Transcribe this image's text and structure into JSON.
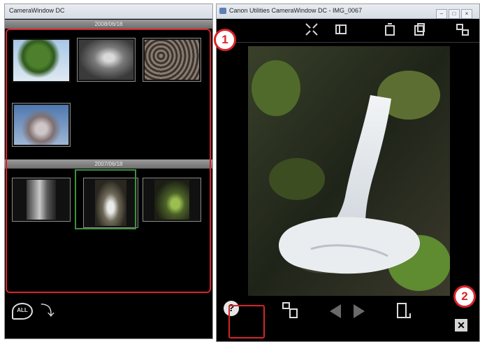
{
  "left_window": {
    "title": "CameraWindow DC",
    "group1_label": "2008/06/18",
    "group2_label": "2007/06/18",
    "bottom_all_label": "ALL"
  },
  "right_window": {
    "title": "Canon Utilities CameraWindow DC - IMG_0067",
    "window_buttons": [
      "–",
      "□",
      "×"
    ]
  },
  "callouts": {
    "one": "1",
    "two": "2"
  },
  "colors": {
    "annotation_red": "#d8232a",
    "selection_green": "#3f8f3f"
  }
}
